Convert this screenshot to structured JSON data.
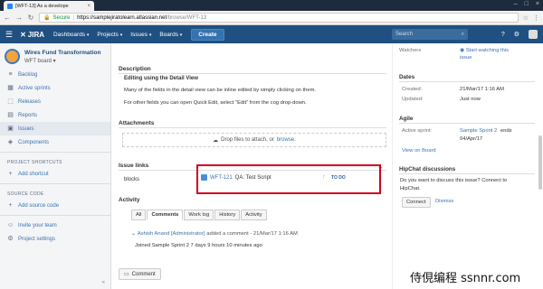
{
  "browser": {
    "tab_title": "[WFT-13] As a develope",
    "tab_close": "×",
    "secure_label": "Secure",
    "url_host": "https://samplejiratolearn.atlassian.net",
    "url_path": "/browse/WFT-13",
    "window_controls": [
      "–",
      "□",
      "×"
    ]
  },
  "header": {
    "logo": "JIRA",
    "nav": [
      "Dashboards",
      "Projects",
      "Issues",
      "Boards"
    ],
    "create_label": "Create",
    "search_placeholder": "Search"
  },
  "sidebar": {
    "project_name": "Wires Fund Transformation",
    "board_name": "WFT board",
    "items": [
      {
        "label": "Backlog",
        "icon": "backlog-icon"
      },
      {
        "label": "Active sprints",
        "icon": "sprints-icon"
      },
      {
        "label": "Releases",
        "icon": "releases-icon"
      },
      {
        "label": "Reports",
        "icon": "reports-icon"
      },
      {
        "label": "Issues",
        "icon": "issues-icon"
      },
      {
        "label": "Components",
        "icon": "components-icon"
      }
    ],
    "shortcuts_heading": "PROJECT SHORTCUTS",
    "add_shortcut": "Add shortcut",
    "source_heading": "SOURCE CODE",
    "add_source": "Add source code",
    "invite": "Invite your team",
    "settings": "Project settings",
    "collapse": "«"
  },
  "main": {
    "description_heading": "Description",
    "desc_title": "Editing using the Detail View",
    "desc_p1": "Many of the fields in the detail view can be inline edited by simply clicking on them.",
    "desc_p2": "For other fields you can open Quick Edit, select \"Edit\" from the cog drop-down.",
    "attachments_heading": "Attachments",
    "drop_text": "Drop files to attach, or",
    "browse_link": "browse.",
    "issue_links_heading": "Issue links",
    "link_type": "blocks",
    "linked_issue_key": "WFT-121",
    "linked_issue_summary": "QA: Test Script",
    "linked_issue_status": "TO DO",
    "activity_heading": "Activity",
    "activity_tabs": [
      "All",
      "Comments",
      "Work log",
      "History",
      "Activity"
    ],
    "comment_user": "Ashish Anand [Administrator]",
    "comment_meta": "added a comment - 21/Mar/17 1:16 AM",
    "comment_body": "Joined Sample Sprint 2 7 days 9 hours 10 minutes ago",
    "comment_button": "Comment"
  },
  "right": {
    "watchers_label": "Watchers",
    "watch_link_1": "Start watching this",
    "watch_link_2": "issue",
    "dates_heading": "Dates",
    "created_label": "Created:",
    "created_value": "21/Mar/17 1:16 AM",
    "updated_label": "Updated:",
    "updated_value": "Just now",
    "agile_heading": "Agile",
    "active_sprint_label": "Active sprint:",
    "active_sprint_value": "Sample Sprint 2",
    "sprint_ends": "ends",
    "sprint_end_date": "04/Apr/17",
    "view_on_board": "View on Board",
    "hipchat_heading": "HipChat discussions",
    "hipchat_q1": "Do you want to discuss this issue? Connect to",
    "hipchat_q2": "HipChat.",
    "connect_label": "Connect",
    "dismiss_label": "Dismiss"
  },
  "watermark": "侍俔编程 ssnnr.com",
  "colors": {
    "header_bg": "#205081",
    "link": "#3b73af",
    "highlight_box": "#d0021b"
  }
}
